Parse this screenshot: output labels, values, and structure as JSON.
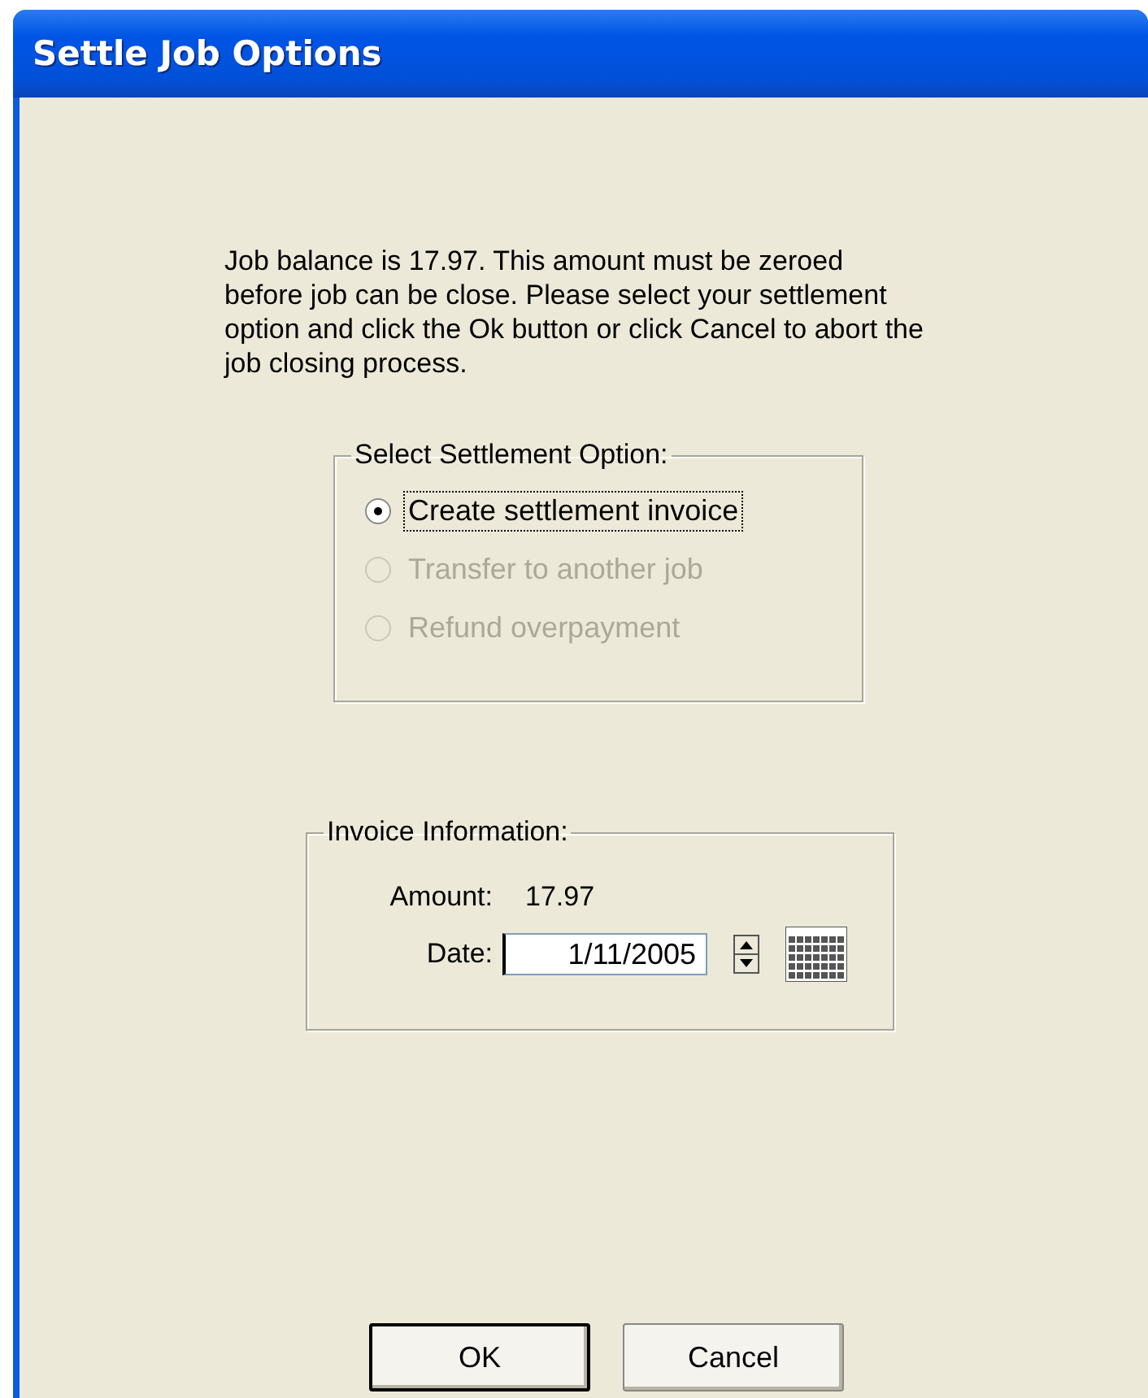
{
  "window": {
    "title": "Settle Job Options"
  },
  "message": "Job balance is 17.97. This amount must be zeroed before job can be close. Please select your settlement option and click the Ok button or click Cancel to abort the job closing process.",
  "settlement_group": {
    "title": "Select Settlement Option:",
    "options": [
      {
        "label": "Create settlement invoice",
        "selected": true,
        "disabled": false,
        "focused": true
      },
      {
        "label": "Transfer to another job",
        "selected": false,
        "disabled": true,
        "focused": false
      },
      {
        "label": "Refund overpayment",
        "selected": false,
        "disabled": true,
        "focused": false
      }
    ]
  },
  "invoice_group": {
    "title": "Invoice Information:",
    "amount_label": "Amount:",
    "amount": "17.97",
    "date_label": "Date:",
    "date": "1/11/2005"
  },
  "buttons": [
    {
      "label": "OK",
      "default": true
    },
    {
      "label": "Cancel",
      "default": false
    }
  ]
}
